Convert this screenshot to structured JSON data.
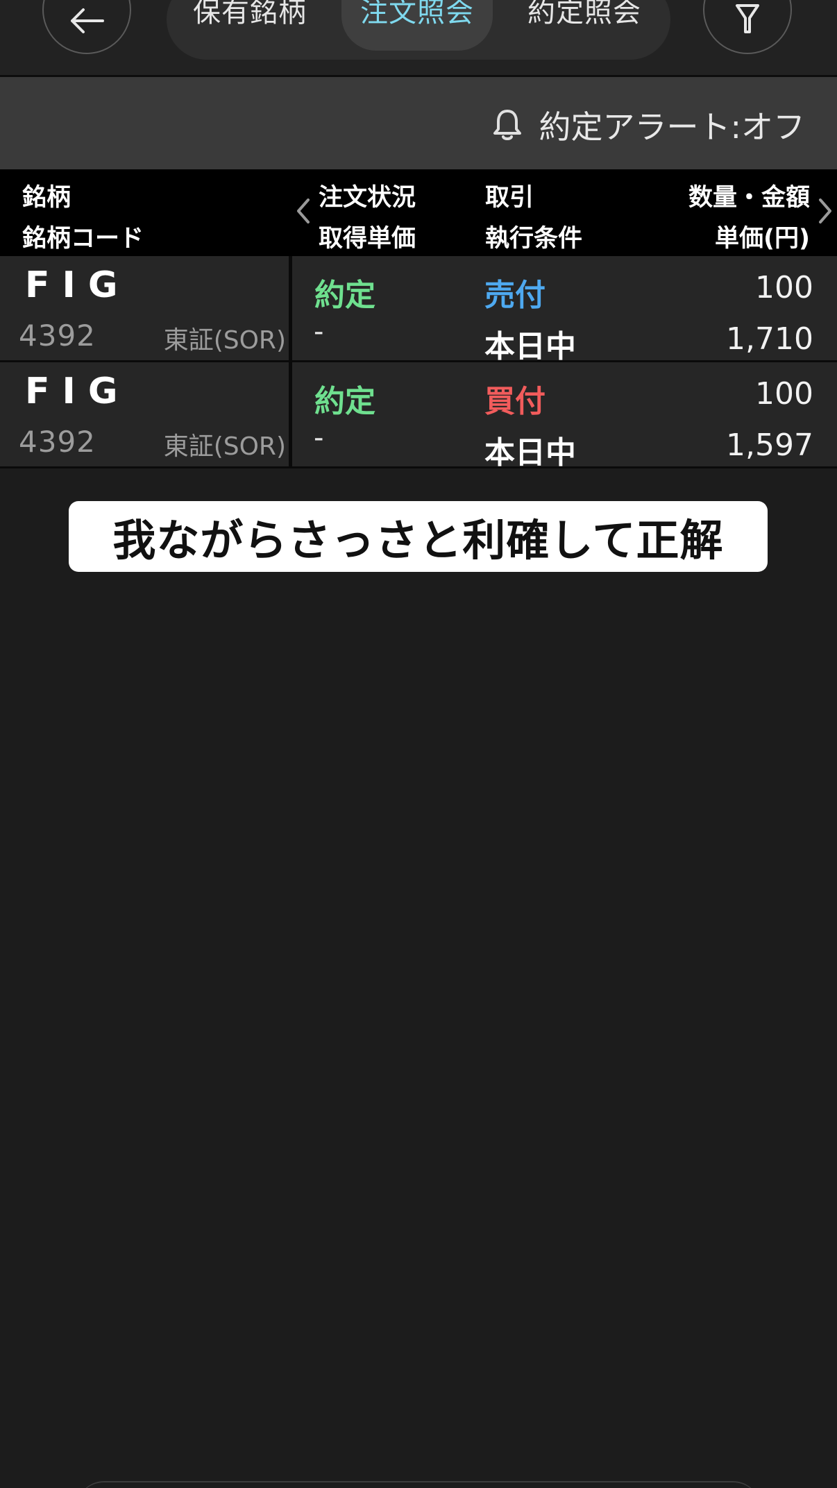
{
  "nav": {
    "tabs": [
      {
        "label": "保有銘柄"
      },
      {
        "label": "注文照会",
        "active": true
      },
      {
        "label": "約定照会"
      }
    ],
    "back_icon": "arrow-left-icon",
    "filter_icon": "filter-icon"
  },
  "alert": {
    "label": "約定アラート:オフ",
    "icon": "bell-icon"
  },
  "table": {
    "headers": {
      "col1_top": "銘柄",
      "col1_bottom": "銘柄コード",
      "col2_top": "注文状況",
      "col2_bottom": "取得単価",
      "col3_top": "取引",
      "col3_bottom": "執行条件",
      "col4_top": "数量・金額",
      "col4_bottom": "単価(円)"
    },
    "rows": [
      {
        "name": "FIG",
        "code": "4392",
        "market": "東証(SOR)",
        "status": "約定",
        "acq_price": "-",
        "trade": "売付",
        "exec": "本日中",
        "qty": "100",
        "price": "1,710"
      },
      {
        "name": "FIG",
        "code": "4392",
        "market": "東証(SOR)",
        "status": "約定",
        "acq_price": "-",
        "trade": "買付",
        "exec": "本日中",
        "qty": "100",
        "price": "1,597"
      }
    ]
  },
  "caption": "我ながらさっさと利確して正解",
  "colors": {
    "status_green": "#6fe08f",
    "sell_blue": "#4ea9f0",
    "buy_red": "#f25c5c",
    "active_tab": "#7fd9ee"
  }
}
